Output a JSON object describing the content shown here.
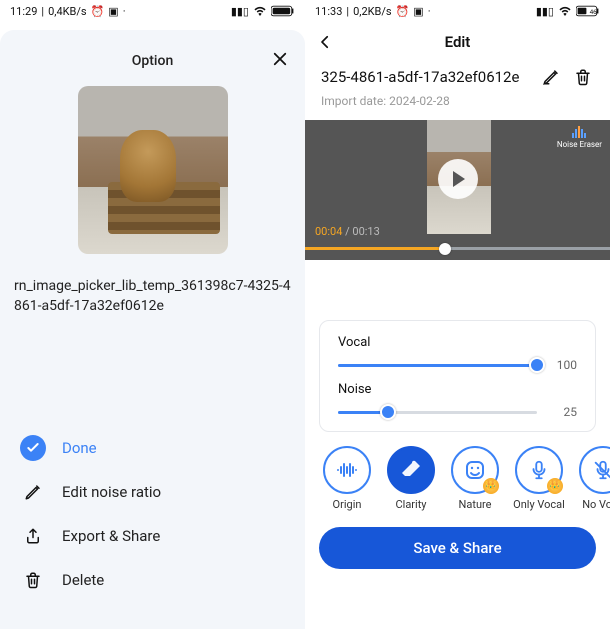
{
  "left": {
    "status": {
      "time": "11:29",
      "net": "0,4KB/s"
    },
    "sheet_title": "Option",
    "filename": "rn_image_picker_lib_temp_361398c7-4325-4861-a5df-17a32ef0612e",
    "menu": {
      "done": "Done",
      "edit_ratio": "Edit noise ratio",
      "export": "Export & Share",
      "delete": "Delete"
    }
  },
  "right": {
    "status": {
      "time": "11:33",
      "net": "0,2KB/s",
      "battery": "46"
    },
    "header_title": "Edit",
    "title": "325-4861-a5df-17a32ef0612e",
    "import_label": "Import date:",
    "import_date": "2024-02-28",
    "noise_eraser": "Noise Eraser",
    "time_current": "00:04",
    "time_sep": " / ",
    "time_duration": "00:13",
    "sliders": {
      "vocal_label": "Vocal",
      "vocal_value": "100",
      "noise_label": "Noise",
      "noise_value": "25"
    },
    "modes": {
      "origin": "Origin",
      "clarity": "Clarity",
      "nature": "Nature",
      "only_vocal": "Only Vocal",
      "no_vocal": "No Voca"
    },
    "save": "Save & Share"
  }
}
